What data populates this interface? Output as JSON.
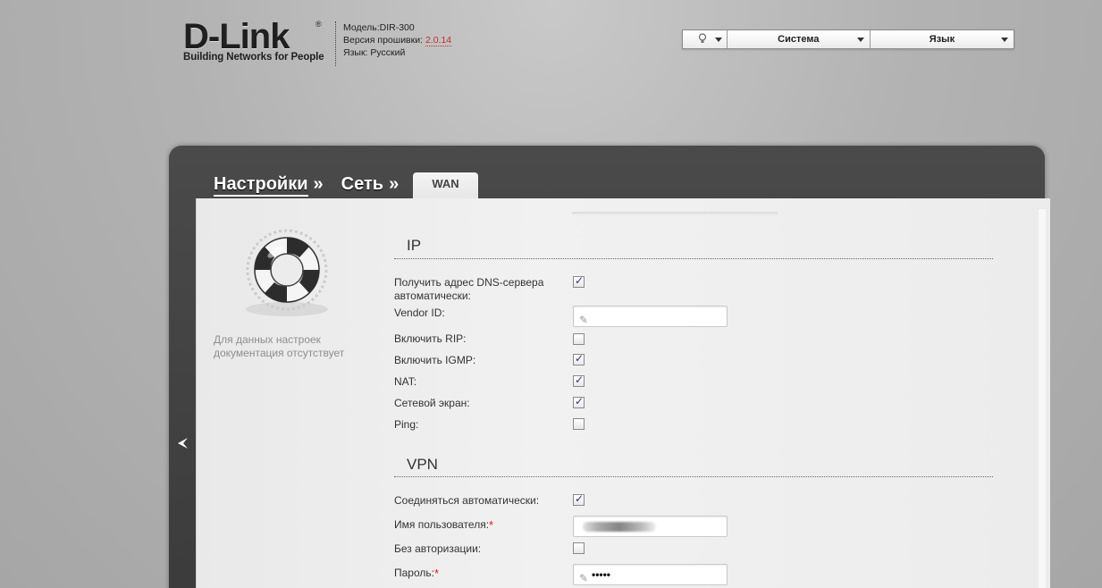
{
  "header": {
    "logo_text": "D-Link",
    "logo_reg": "®",
    "logo_tagline": "Building Networks for People",
    "model_label": "Модель:",
    "model_value": "DIR-300",
    "firmware_label": "Версия прошивки:",
    "firmware_value": "2.0.14",
    "language_label": "Язык:",
    "language_value": "Русский"
  },
  "topmenu": {
    "system_label": "Система",
    "language_label": "Язык"
  },
  "breadcrumbs": {
    "item1": "Настройки",
    "item2": "Сеть",
    "separator": "»",
    "active_tab": "WAN"
  },
  "help": {
    "text": "Для данных настроек документация отсутствует"
  },
  "ip_section": {
    "title": "IP",
    "fields": [
      {
        "label": "Получить адрес DNS-сервера автоматически:",
        "type": "checkbox",
        "checked": true
      },
      {
        "label": "Vendor ID:",
        "type": "text",
        "value": ""
      },
      {
        "label": "Включить RIP:",
        "type": "checkbox",
        "checked": false
      },
      {
        "label": "Включить IGMP:",
        "type": "checkbox",
        "checked": true
      },
      {
        "label": "NAT:",
        "type": "checkbox",
        "checked": true
      },
      {
        "label": "Сетевой экран:",
        "type": "checkbox",
        "checked": true
      },
      {
        "label": "Ping:",
        "type": "checkbox",
        "checked": false
      }
    ]
  },
  "vpn_section": {
    "title": "VPN",
    "fields": [
      {
        "label": "Соединяться автоматически:",
        "type": "checkbox",
        "checked": true
      },
      {
        "label": "Имя пользователя:",
        "required_mark": "*",
        "type": "text",
        "value": "(redacted)"
      },
      {
        "label": "Без авторизации:",
        "type": "checkbox",
        "checked": false
      },
      {
        "label": "Пароль:",
        "required_mark": "*",
        "type": "password",
        "value": "•••••"
      }
    ]
  },
  "icons": {
    "bulb": "lightbulb-icon",
    "pencil": "pencil-icon",
    "arrow": "left-arrow-icon",
    "buoy": "lifebuoy-icon"
  }
}
